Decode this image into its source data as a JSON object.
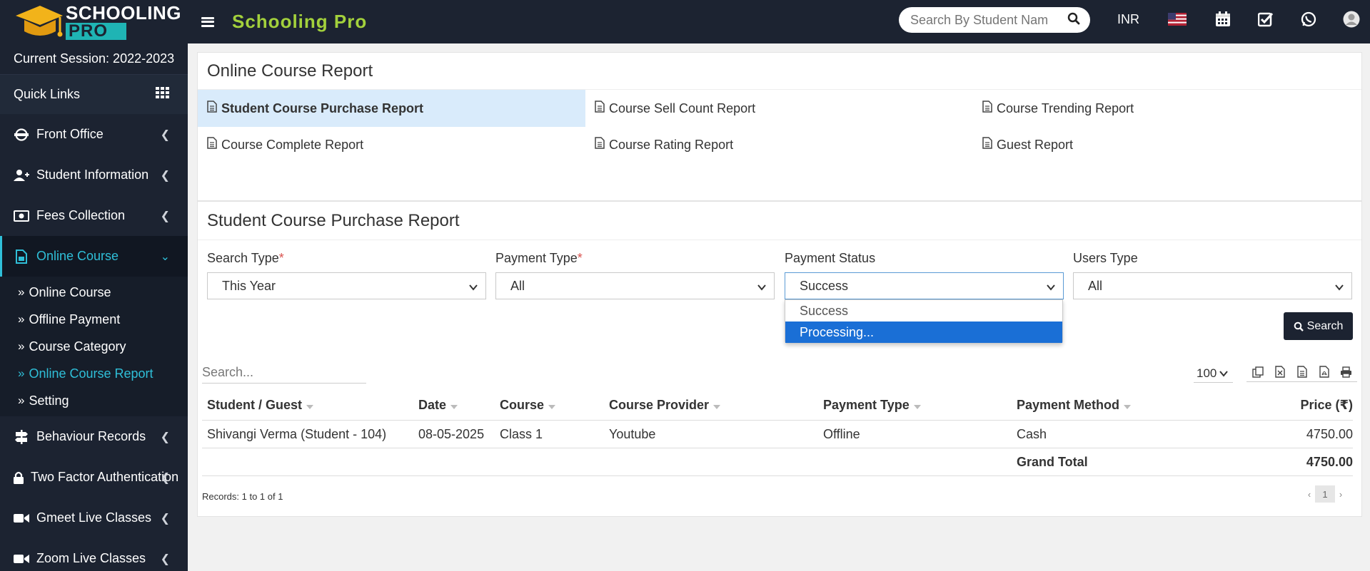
{
  "logo": {
    "line1": "SCHOOLING",
    "line2": "PRO"
  },
  "header": {
    "brand": "Schooling Pro",
    "search_placeholder": "Search By Student Nam",
    "currency": "INR"
  },
  "sidebar": {
    "session": "Current Session: 2022-2023",
    "quick_links": "Quick Links",
    "items": [
      {
        "label": "Front Office",
        "icon": "front-office-icon"
      },
      {
        "label": "Student Information",
        "icon": "user-plus-icon"
      },
      {
        "label": "Fees Collection",
        "icon": "money-icon"
      },
      {
        "label": "Online Course",
        "icon": "course-icon",
        "active": true
      },
      {
        "label": "Behaviour Records",
        "icon": "signpost-icon"
      },
      {
        "label": "Two Factor Authentication",
        "icon": "lock-icon"
      },
      {
        "label": "Gmeet Live Classes",
        "icon": "video-icon"
      },
      {
        "label": "Zoom Live Classes",
        "icon": "video-icon"
      }
    ],
    "sub_items": [
      "Online Course",
      "Offline Payment",
      "Course Category",
      "Online Course Report",
      "Setting"
    ]
  },
  "report_panel": {
    "title": "Online Course Report",
    "links": [
      "Student Course Purchase Report",
      "Course Sell Count Report",
      "Course Trending Report",
      "Course Complete Report",
      "Course Rating Report",
      "Guest Report"
    ]
  },
  "purchase_panel": {
    "title": "Student Course Purchase Report",
    "filters": {
      "search_type": {
        "label": "Search Type",
        "value": "This Year"
      },
      "payment_type": {
        "label": "Payment Type",
        "value": "All"
      },
      "payment_status": {
        "label": "Payment Status",
        "value": "Success",
        "options": [
          "Success",
          "Processing..."
        ]
      },
      "users_type": {
        "label": "Users Type",
        "value": "All"
      }
    },
    "search_button": "Search",
    "table_search_placeholder": "Search...",
    "per_page": "100",
    "columns": [
      "Student / Guest",
      "Date",
      "Course",
      "Course Provider",
      "Payment Type",
      "Payment Method",
      "Price (₹)"
    ],
    "rows": [
      {
        "student": "Shivangi Verma (Student - 104)",
        "date": "08-05-2025",
        "course": "Class 1",
        "provider": "Youtube",
        "payment_type": "Offline",
        "payment_method": "Cash",
        "price": "4750.00"
      }
    ],
    "grand_total_label": "Grand Total",
    "grand_total": "4750.00",
    "records_text": "Records: 1 to 1 of 1",
    "current_page": "1"
  },
  "colors": {
    "header_bg": "#1c2331",
    "brand": "#a3d13c",
    "accent": "#2fbfd8",
    "highlight": "#1a6fd6",
    "active_link_bg": "#d9ebfb"
  }
}
